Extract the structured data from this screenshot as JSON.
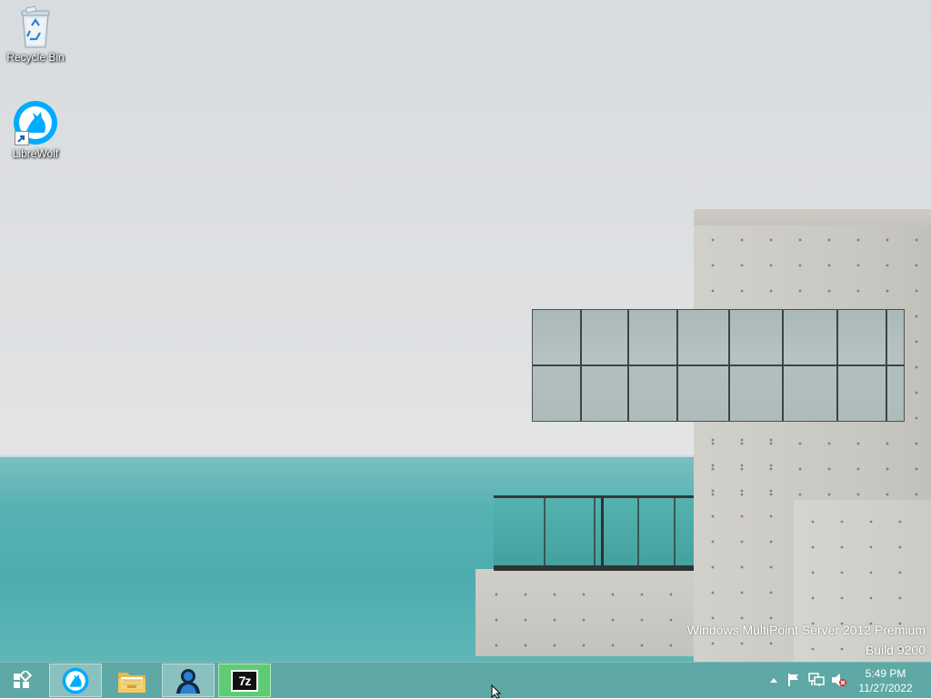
{
  "desktop": {
    "icons": [
      {
        "label": "Recycle Bin",
        "icon": "recycle-bin-icon"
      },
      {
        "label": "LibreWolf",
        "icon": "librewolf-icon",
        "shortcut": true
      }
    ],
    "watermark": {
      "edition": "Windows MultiPoint Server 2012 Premium",
      "build": "Build 9200"
    }
  },
  "taskbar": {
    "start_icon": "start-icon",
    "pinned": [
      {
        "name": "LibreWolf",
        "icon": "librewolf-icon",
        "state": "active"
      },
      {
        "name": "File Explorer",
        "icon": "file-explorer-icon",
        "state": "normal"
      },
      {
        "name": "MultiPoint",
        "icon": "multipoint-users-icon",
        "state": "active"
      },
      {
        "name": "7-Zip",
        "icon": "7zip-icon",
        "label": "7z",
        "state": "highlighted"
      }
    ],
    "tray": {
      "icons": [
        "show-hidden-icons-chevron-icon",
        "action-center-flag-icon",
        "network-icon",
        "volume-muted-icon"
      ],
      "time": "5:49 PM",
      "date": "11/27/2022"
    },
    "colors": {
      "taskbar": "#5ea8a5",
      "active_highlight": "#5fcc75"
    }
  }
}
